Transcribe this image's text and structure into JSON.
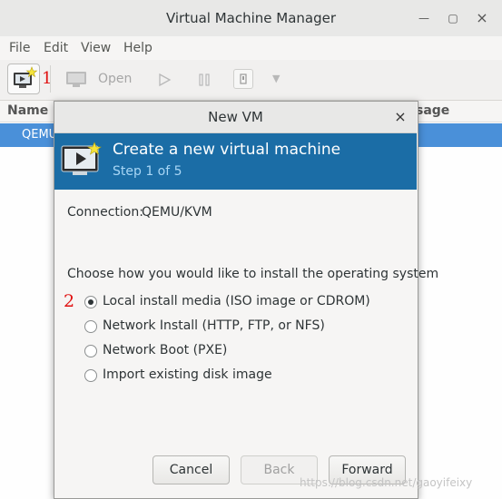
{
  "window": {
    "title": "Virtual Machine Manager"
  },
  "menu": [
    "File",
    "Edit",
    "View",
    "Help"
  ],
  "toolbar": {
    "open_label": "Open"
  },
  "vm_list": {
    "columns": [
      "Name",
      "sage"
    ],
    "rows": [
      "QEMU"
    ]
  },
  "annotations": {
    "mark1": "1",
    "mark2": "2"
  },
  "dialog": {
    "title": "New VM",
    "close_glyph": "×",
    "banner_title": "Create a new virtual machine",
    "banner_step": "Step 1 of 5",
    "connection_label": "Connection:",
    "connection_value": "QEMU/KVM",
    "prompt": "Choose how you would like to install the operating system",
    "options": [
      {
        "label": "Local install media (ISO image or CDROM)",
        "selected": true
      },
      {
        "label": "Network Install (HTTP, FTP, or NFS)",
        "selected": false
      },
      {
        "label": "Network Boot (PXE)",
        "selected": false
      },
      {
        "label": "Import existing disk image",
        "selected": false
      }
    ],
    "buttons": {
      "cancel": "Cancel",
      "back": "Back",
      "forward": "Forward"
    }
  },
  "watermark": "https://blog.csdn.net/gaoyifeixy",
  "colors": {
    "banner": "#1b6da6",
    "selection": "#4a90d9",
    "annotation": "#e01010"
  }
}
